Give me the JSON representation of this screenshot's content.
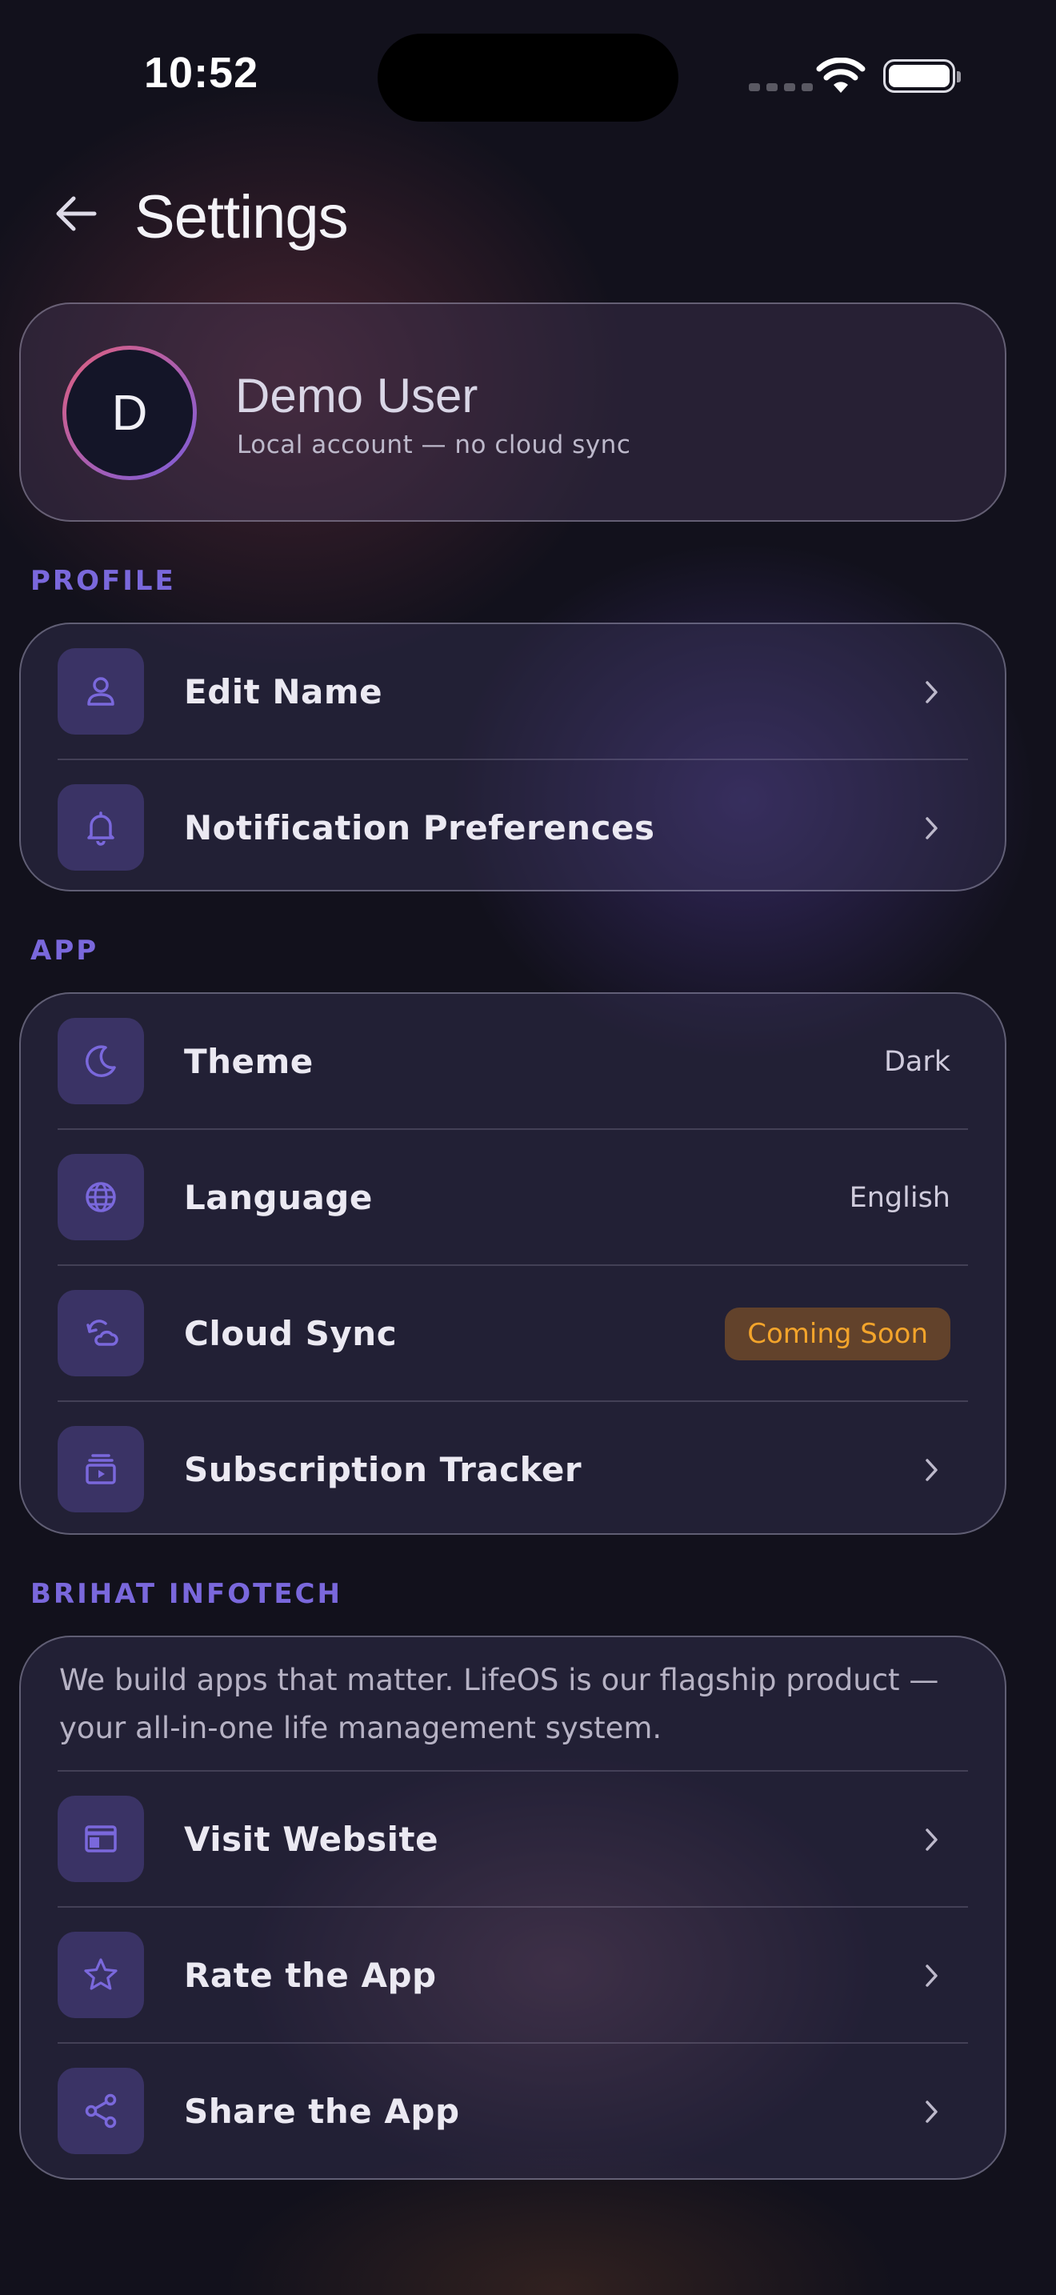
{
  "status_bar": {
    "time": "10:52"
  },
  "header": {
    "title": "Settings"
  },
  "profile_card": {
    "initial": "D",
    "name": "Demo User",
    "subtitle": "Local account — no cloud sync"
  },
  "sections": {
    "profile": {
      "label": "PROFILE",
      "items": [
        {
          "label": "Edit Name",
          "icon": "person-icon"
        },
        {
          "label": "Notification Preferences",
          "icon": "bell-icon"
        }
      ]
    },
    "app": {
      "label": "APP",
      "items": [
        {
          "label": "Theme",
          "value": "Dark",
          "icon": "moon-icon"
        },
        {
          "label": "Language",
          "value": "English",
          "icon": "globe-icon"
        },
        {
          "label": "Cloud Sync",
          "badge": "Coming Soon",
          "icon": "sync-icon"
        },
        {
          "label": "Subscription Tracker",
          "icon": "subscriptions-icon"
        }
      ]
    },
    "brihat": {
      "label": "BRIHAT INFOTECH",
      "description": "We build apps that matter. LifeOS is our flagship product — your all-in-one life management system.",
      "items": [
        {
          "label": "Visit Website",
          "icon": "browser-icon"
        },
        {
          "label": "Rate the App",
          "icon": "star-icon"
        },
        {
          "label": "Share the App",
          "icon": "share-icon"
        }
      ]
    }
  },
  "colors": {
    "accent": "#7a68dc",
    "badge_text": "#f3a42b",
    "background": "#12111c"
  }
}
